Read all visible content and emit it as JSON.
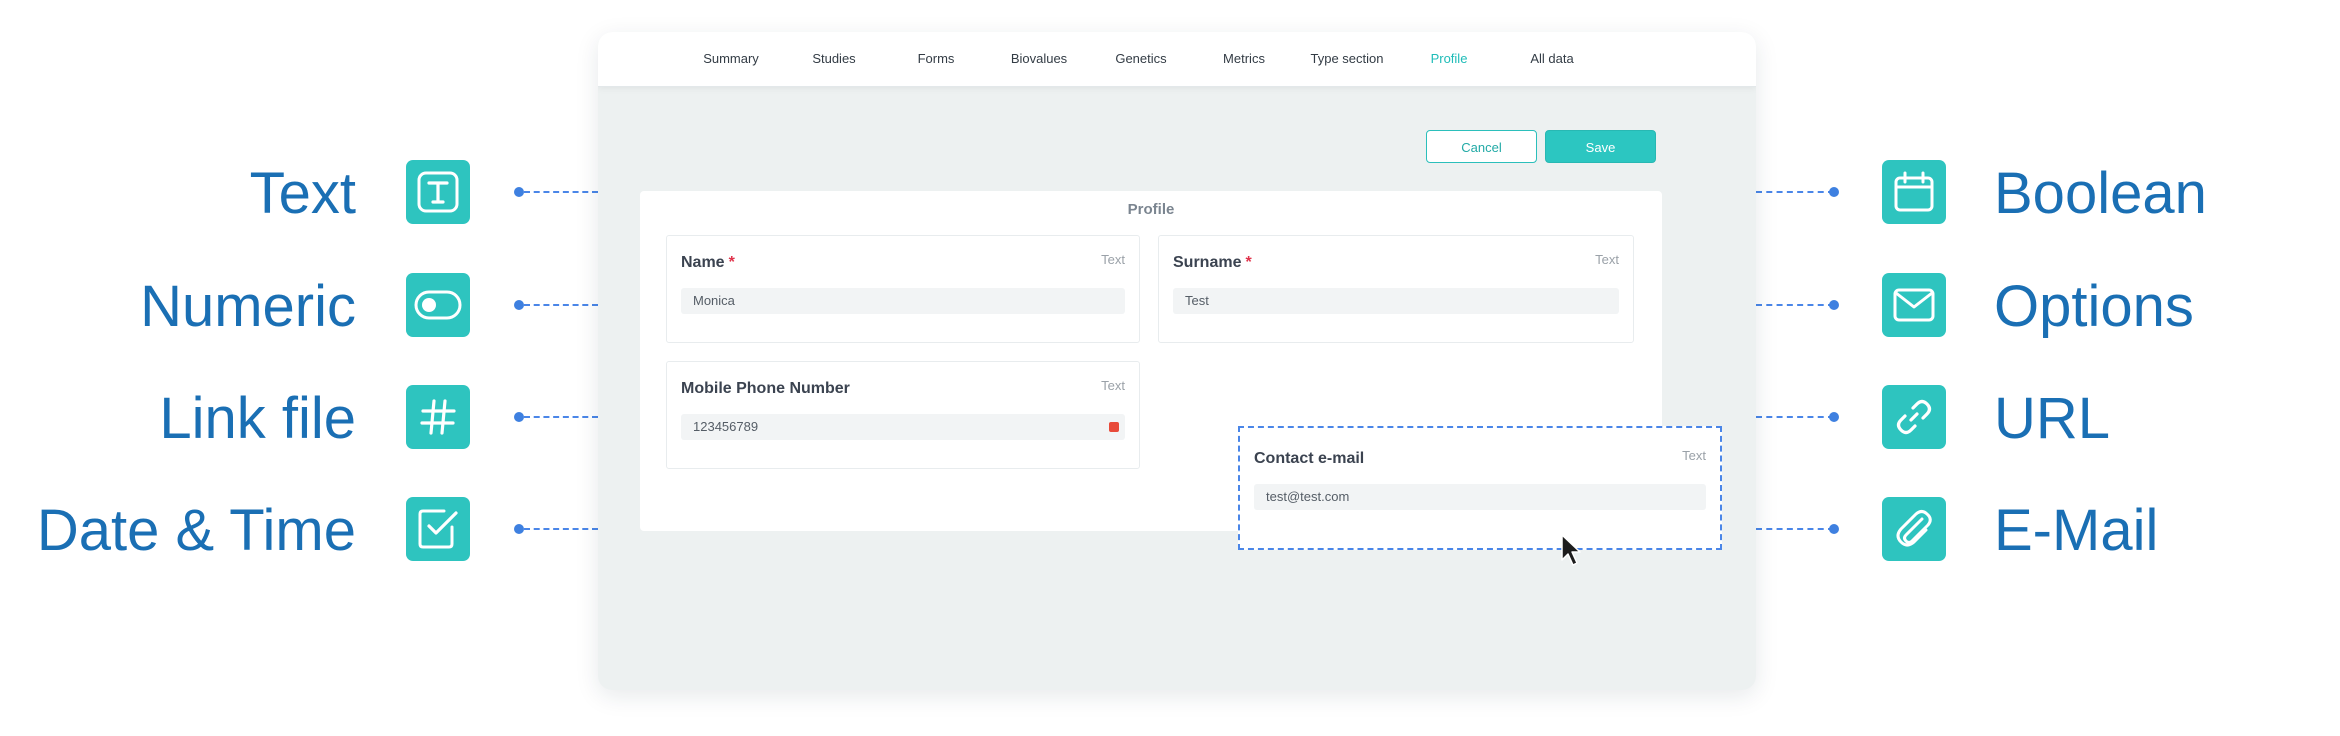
{
  "nav": {
    "tabs": [
      {
        "label": "Summary"
      },
      {
        "label": "Studies"
      },
      {
        "label": "Forms"
      },
      {
        "label": "Biovalues"
      },
      {
        "label": "Genetics"
      },
      {
        "label": "Metrics"
      },
      {
        "label": "Type section"
      },
      {
        "label": "Profile"
      },
      {
        "label": "All data"
      }
    ],
    "active_tab": "Profile"
  },
  "actions": {
    "cancel_label": "Cancel",
    "save_label": "Save"
  },
  "profile": {
    "title": "Profile",
    "fields": [
      {
        "label": "Name",
        "required_mark": "*",
        "type": "Text",
        "value": "Monica"
      },
      {
        "label": "Surname",
        "required_mark": "*",
        "type": "Text",
        "value": "Test"
      },
      {
        "label": "Mobile Phone Number",
        "type": "Text",
        "value": "123456789"
      }
    ]
  },
  "dragged_field": {
    "label": "Contact e-mail",
    "type": "Text",
    "value": "test@test.com"
  },
  "legend": {
    "left": [
      {
        "label": "Text",
        "icon": "text-icon"
      },
      {
        "label": "Numeric",
        "icon": "toggle-icon"
      },
      {
        "label": "Link file",
        "icon": "hash-icon"
      },
      {
        "label": "Date & Time",
        "icon": "checkbox-icon"
      }
    ],
    "right": [
      {
        "label": "Boolean",
        "icon": "calendar-icon"
      },
      {
        "label": "Options",
        "icon": "mail-icon"
      },
      {
        "label": "URL",
        "icon": "link-icon"
      },
      {
        "label": "E-Mail",
        "icon": "paperclip-icon"
      }
    ]
  },
  "colors": {
    "accent": "#2ec4bf",
    "label_blue": "#1a6fb4",
    "dash_blue": "#4a86e8",
    "required": "#e0334b"
  }
}
